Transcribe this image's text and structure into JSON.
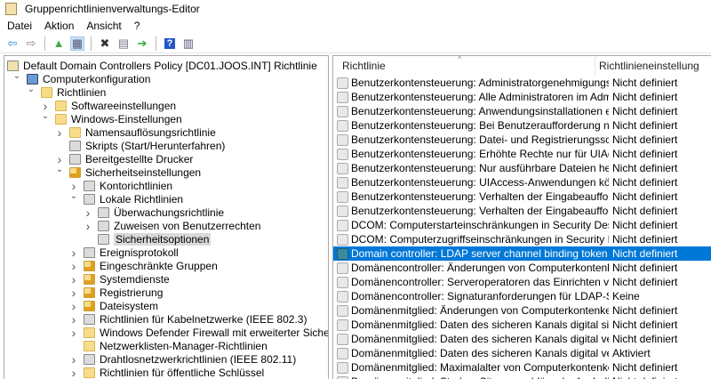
{
  "window": {
    "title": "Gruppenrichtlinienverwaltungs-Editor"
  },
  "menu": [
    "Datei",
    "Aktion",
    "Ansicht",
    "?"
  ],
  "toolbar": [
    {
      "icon": "back-icon",
      "glyph": "⇦",
      "color": "#1e88d8"
    },
    {
      "icon": "forward-icon",
      "glyph": "⇨",
      "color": "#888"
    },
    {
      "sep": true
    },
    {
      "icon": "up-folder-icon",
      "glyph": "▲",
      "color": "#4a4"
    },
    {
      "icon": "show-hide-tree-icon",
      "glyph": "▦",
      "color": "#557",
      "on": true
    },
    {
      "sep": true
    },
    {
      "icon": "delete-icon",
      "glyph": "✖",
      "color": "#333"
    },
    {
      "icon": "properties-icon",
      "glyph": "▤",
      "color": "#778"
    },
    {
      "icon": "export-icon",
      "glyph": "➔",
      "color": "#3a3"
    },
    {
      "sep": true
    },
    {
      "icon": "help-icon",
      "glyph": "?",
      "color": "#fff",
      "bg": "#2457c5"
    },
    {
      "icon": "show-action-pane-icon",
      "glyph": "▥",
      "color": "#557"
    }
  ],
  "tree": [
    {
      "label": "Default Domain Controllers Policy [DC01.JOOS.INT] Richtlinie",
      "level": 0,
      "chev": "",
      "icon": "policy"
    },
    {
      "label": "Computerkonfiguration",
      "level": 1,
      "chev": "v",
      "icon": "computer"
    },
    {
      "label": "Richtlinien",
      "level": 2,
      "chev": "v",
      "icon": "folder"
    },
    {
      "label": "Softwareeinstellungen",
      "level": 3,
      "chev": ">",
      "icon": "folder"
    },
    {
      "label": "Windows-Einstellungen",
      "level": 3,
      "chev": "v",
      "icon": "folder"
    },
    {
      "label": "Namensauflösungsrichtlinie",
      "level": 4,
      "chev": ">",
      "icon": "folder"
    },
    {
      "label": "Skripts (Start/Herunterfahren)",
      "level": 4,
      "chev": "",
      "icon": "sec"
    },
    {
      "label": "Bereitgestellte Drucker",
      "level": 4,
      "chev": ">",
      "icon": "sec"
    },
    {
      "label": "Sicherheitseinstellungen",
      "level": 4,
      "chev": "v",
      "icon": "lock"
    },
    {
      "label": "Kontorichtlinien",
      "level": 5,
      "chev": ">",
      "icon": "sec"
    },
    {
      "label": "Lokale Richtlinien",
      "level": 5,
      "chev": "v",
      "icon": "sec"
    },
    {
      "label": "Überwachungsrichtlinie",
      "level": 6,
      "chev": ">",
      "icon": "sec"
    },
    {
      "label": "Zuweisen von Benutzerrechten",
      "level": 6,
      "chev": ">",
      "icon": "sec"
    },
    {
      "label": "Sicherheitsoptionen",
      "level": 6,
      "chev": "",
      "icon": "sec",
      "selected": true
    },
    {
      "label": "Ereignisprotokoll",
      "level": 5,
      "chev": ">",
      "icon": "sec"
    },
    {
      "label": "Eingeschränkte Gruppen",
      "level": 5,
      "chev": ">",
      "icon": "lock"
    },
    {
      "label": "Systemdienste",
      "level": 5,
      "chev": ">",
      "icon": "lock"
    },
    {
      "label": "Registrierung",
      "level": 5,
      "chev": ">",
      "icon": "lock"
    },
    {
      "label": "Dateisystem",
      "level": 5,
      "chev": ">",
      "icon": "lock"
    },
    {
      "label": "Richtlinien für Kabelnetzwerke (IEEE 802.3)",
      "level": 5,
      "chev": ">",
      "icon": "sec"
    },
    {
      "label": "Windows Defender Firewall mit erweiterter Sicherheit",
      "level": 5,
      "chev": ">",
      "icon": "folder"
    },
    {
      "label": "Netzwerklisten-Manager-Richtlinien",
      "level": 5,
      "chev": "",
      "icon": "folder"
    },
    {
      "label": "Drahtlosnetzwerkrichtlinien (IEEE 802.11)",
      "level": 5,
      "chev": ">",
      "icon": "sec"
    },
    {
      "label": "Richtlinien für öffentliche Schlüssel",
      "level": 5,
      "chev": ">",
      "icon": "folder"
    }
  ],
  "list": {
    "columns": [
      "Richtlinie",
      "Richtlinieneinstellung"
    ],
    "rows": [
      [
        "Benutzerkontensteuerung: Administratorgenehmigungsmo...",
        "Nicht definiert"
      ],
      [
        "Benutzerkontensteuerung: Alle Administratoren im Adminis...",
        "Nicht definiert"
      ],
      [
        "Benutzerkontensteuerung: Anwendungsinstallationen erken...",
        "Nicht definiert"
      ],
      [
        "Benutzerkontensteuerung: Bei Benutzeraufforderung nach e...",
        "Nicht definiert"
      ],
      [
        "Benutzerkontensteuerung: Datei- und Registrierungsschreib...",
        "Nicht definiert"
      ],
      [
        "Benutzerkontensteuerung: Erhöhte Rechte nur für UIAccess-...",
        "Nicht definiert"
      ],
      [
        "Benutzerkontensteuerung: Nur ausführbare Dateien heraufst...",
        "Nicht definiert"
      ],
      [
        "Benutzerkontensteuerung: UIAccess-Anwendungen können...",
        "Nicht definiert"
      ],
      [
        "Benutzerkontensteuerung: Verhalten der Eingabeaufforderu...",
        "Nicht definiert"
      ],
      [
        "Benutzerkontensteuerung: Verhalten der Eingabeaufforderu...",
        "Nicht definiert"
      ],
      [
        "DCOM: Computerstarteinschränkungen in Security Descript...",
        "Nicht definiert"
      ],
      [
        "DCOM: Computerzugriffseinschränkungen in Security Descr...",
        "Nicht definiert"
      ],
      [
        "Domain controller: LDAP server channel binding token requi...",
        "Nicht definiert"
      ],
      [
        "Domänencontroller: Änderungen von Computerkontenken...",
        "Nicht definiert"
      ],
      [
        "Domänencontroller: Serveroperatoren das Einrichten von ge...",
        "Nicht definiert"
      ],
      [
        "Domänencontroller: Signaturanforderungen für LDAP-Server",
        "Keine"
      ],
      [
        "Domänenmitglied: Änderungen von Computerkontenkenn...",
        "Nicht definiert"
      ],
      [
        "Domänenmitglied: Daten des sicheren Kanals digital signier...",
        "Nicht definiert"
      ],
      [
        "Domänenmitglied: Daten des sicheren Kanals digital verschl...",
        "Nicht definiert"
      ],
      [
        "Domänenmitglied: Daten des sicheren Kanals digital verschl...",
        "Aktiviert"
      ],
      [
        "Domänenmitglied: Maximalalter von Computerkontenkenn...",
        "Nicht definiert"
      ],
      [
        "Domänenmitglied: Starken Sitzungsschlüssel erforderlich (Wi...",
        "Nicht definiert"
      ]
    ],
    "selected_index": 12
  }
}
